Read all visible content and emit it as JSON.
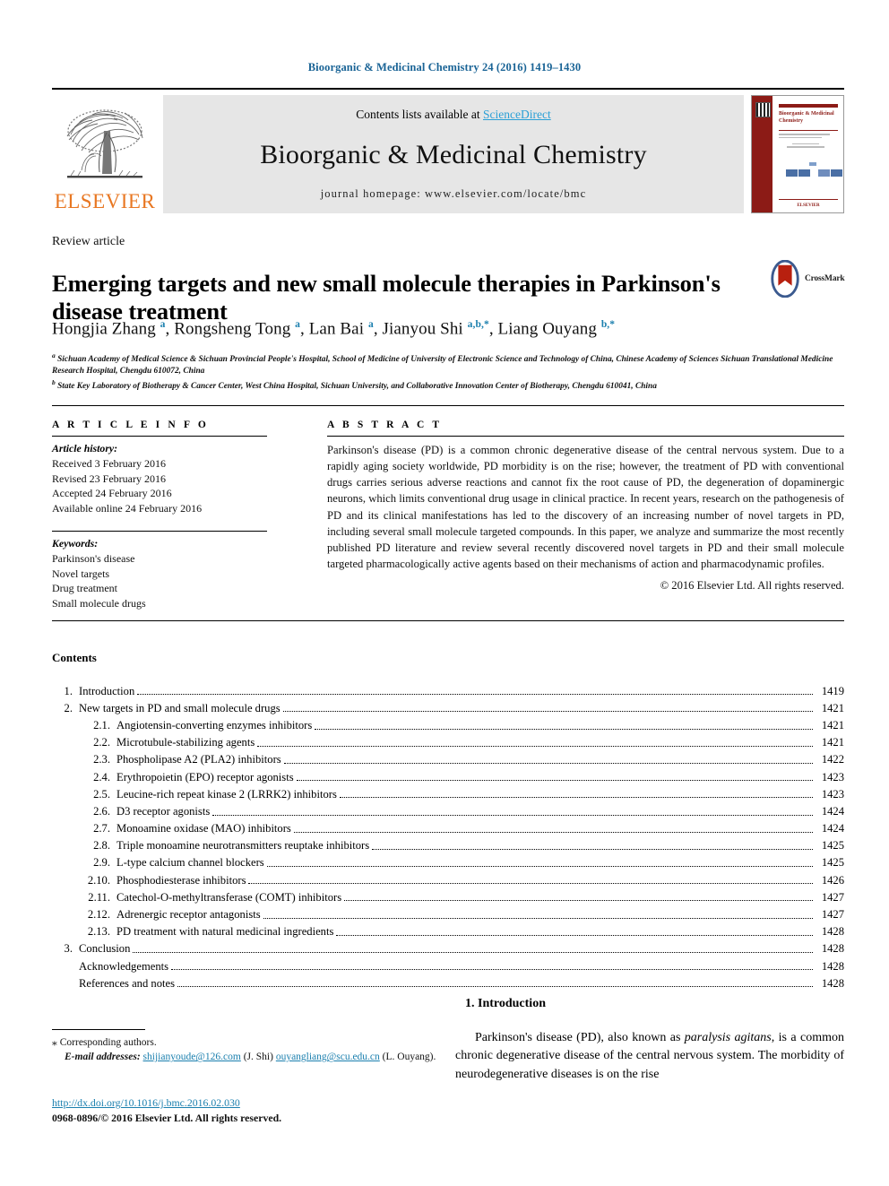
{
  "running_head": "Bioorganic & Medicinal Chemistry 24 (2016) 1419–1430",
  "masthead": {
    "contents_prefix": "Contents lists available at ",
    "sciencedirect": "ScienceDirect",
    "journal_title": "Bioorganic & Medicinal Chemistry",
    "homepage": "journal homepage: www.elsevier.com/locate/bmc",
    "publisher": "ELSEVIER",
    "cover_title": "Bioorganic & Medicinal Chemistry",
    "cover_publisher": "ELSEVIER",
    "accent_blue": "#2a9fd6",
    "elsevier_orange": "#E87722",
    "cover_red": "#8c1b16"
  },
  "article": {
    "type": "Review article",
    "title": "Emerging targets and new small molecule therapies in Parkinson's disease treatment",
    "crossmark_label": "CrossMark",
    "authors_html": "Hongjia Zhang <sup>a</sup>, Rongsheng Tong <sup>a</sup>, Lan Bai <sup>a</sup>, Jianyou Shi <sup>a,b,*</sup>, Liang Ouyang <sup>b,*</sup>",
    "affiliation_a": "Sichuan Academy of Medical Science & Sichuan Provincial People's Hospital, School of Medicine of University of Electronic Science and Technology of China, Chinese Academy of Sciences Sichuan Translational Medicine Research Hospital, Chengdu 610072, China",
    "affiliation_b": "State Key Laboratory of Biotherapy & Cancer Center, West China Hospital, Sichuan University, and Collaborative Innovation Center of Biotherapy, Chengdu 610041, China"
  },
  "article_info": {
    "heading": "A R T I C L E    I N F O",
    "history_label": "Article history:",
    "history": [
      "Received 3 February 2016",
      "Revised 23 February 2016",
      "Accepted 24 February 2016",
      "Available online 24 February 2016"
    ],
    "keywords_label": "Keywords:",
    "keywords": [
      "Parkinson's disease",
      "Novel targets",
      "Drug treatment",
      "Small molecule drugs"
    ]
  },
  "abstract": {
    "heading": "A B S T R A C T",
    "text": "Parkinson's disease (PD) is a common chronic degenerative disease of the central nervous system. Due to a rapidly aging society worldwide, PD morbidity is on the rise; however, the treatment of PD with conventional drugs carries serious adverse reactions and cannot fix the root cause of PD, the degeneration of dopaminergic neurons, which limits conventional drug usage in clinical practice. In recent years, research on the pathogenesis of PD and its clinical manifestations has led to the discovery of an increasing number of novel targets in PD, including several small molecule targeted compounds. In this paper, we analyze and summarize the most recently published PD literature and review several recently discovered novel targets in PD and their small molecule targeted pharmacologically active agents based on their mechanisms of action and pharmacodynamic profiles.",
    "copyright": "© 2016 Elsevier Ltd. All rights reserved."
  },
  "contents": {
    "heading": "Contents",
    "entries": [
      {
        "num": "1.",
        "level": 1,
        "label": "Introduction",
        "page": "1419"
      },
      {
        "num": "2.",
        "level": 1,
        "label": "New targets in PD and small molecule drugs",
        "page": "1421"
      },
      {
        "num": "2.1.",
        "level": 2,
        "label": "Angiotensin-converting enzymes inhibitors",
        "page": "1421"
      },
      {
        "num": "2.2.",
        "level": 2,
        "label": "Microtubule-stabilizing agents",
        "page": "1421"
      },
      {
        "num": "2.3.",
        "level": 2,
        "label": "Phospholipase A2 (PLA2) inhibitors",
        "page": "1422"
      },
      {
        "num": "2.4.",
        "level": 2,
        "label": "Erythropoietin (EPO) receptor agonists",
        "page": "1423"
      },
      {
        "num": "2.5.",
        "level": 2,
        "label": "Leucine-rich repeat kinase 2 (LRRK2) inhibitors",
        "page": "1423"
      },
      {
        "num": "2.6.",
        "level": 2,
        "label": "D3 receptor agonists",
        "page": "1424"
      },
      {
        "num": "2.7.",
        "level": 2,
        "label": "Monoamine oxidase (MAO) inhibitors",
        "page": "1424"
      },
      {
        "num": "2.8.",
        "level": 2,
        "label": "Triple monoamine neurotransmitters reuptake inhibitors",
        "page": "1425"
      },
      {
        "num": "2.9.",
        "level": 2,
        "label": "L-type calcium channel blockers",
        "page": "1425"
      },
      {
        "num": "2.10.",
        "level": 2,
        "label": "Phosphodiesterase inhibitors",
        "page": "1426"
      },
      {
        "num": "2.11.",
        "level": 2,
        "label": "Catechol-O-methyltransferase (COMT) inhibitors",
        "page": "1427"
      },
      {
        "num": "2.12.",
        "level": 2,
        "label": "Adrenergic receptor antagonists",
        "page": "1427"
      },
      {
        "num": "2.13.",
        "level": 2,
        "label": "PD treatment with natural medicinal ingredients",
        "page": "1428"
      },
      {
        "num": "3.",
        "level": 1,
        "label": "Conclusion",
        "page": "1428"
      },
      {
        "num": "",
        "level": 1,
        "label": "Acknowledgements",
        "page": "1428"
      },
      {
        "num": "",
        "level": 1,
        "label": "References and notes",
        "page": "1428"
      }
    ]
  },
  "footnotes": {
    "corresponding": "Corresponding authors.",
    "star": "⁎",
    "email_label": "E-mail addresses:",
    "email_1": "shijianyoude@126.com",
    "email_1_owner": "(J. Shi)",
    "email_2": "ouyangliang@scu.edu.cn",
    "email_2_owner": "(L. Ouyang).",
    "doi": "http://dx.doi.org/10.1016/j.bmc.2016.02.030",
    "issn": "0968-0896/© 2016 Elsevier Ltd. All rights reserved."
  },
  "introduction": {
    "heading": "1. Introduction",
    "paragraph_pre": "Parkinson's disease (PD), also known as ",
    "paragraph_italic": "paralysis agitans",
    "paragraph_post": ", is a common chronic degenerative disease of the central nervous system. The morbidity of neurodegenerative diseases is on the rise"
  }
}
